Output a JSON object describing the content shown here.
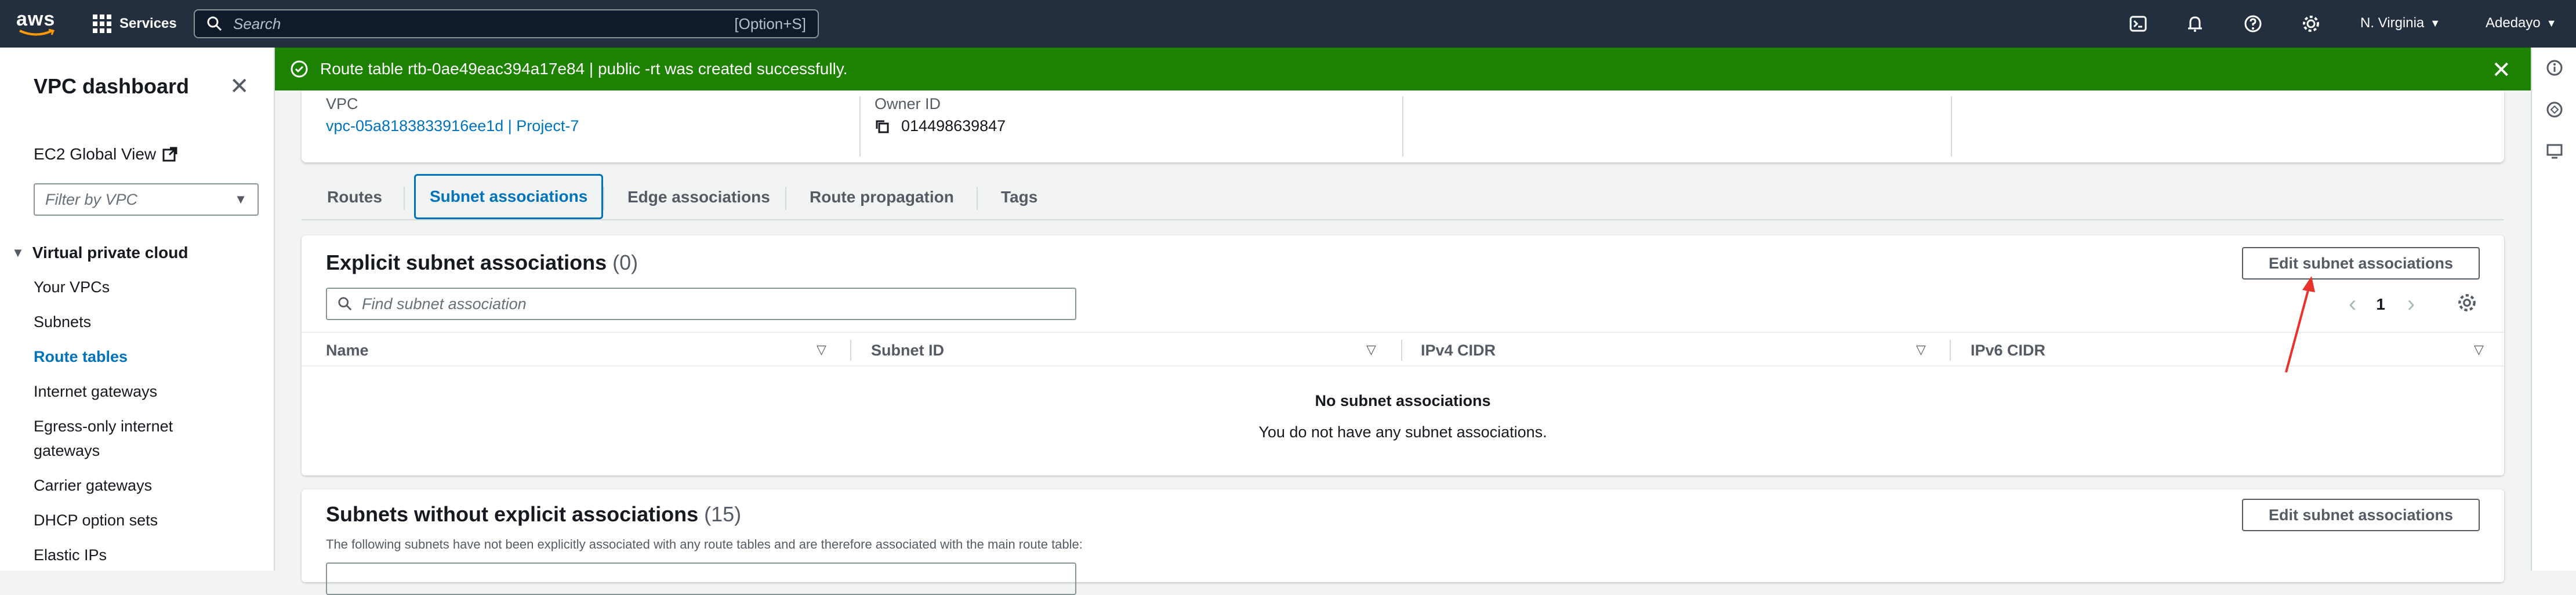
{
  "topnav": {
    "logo": "aws",
    "services_label": "Services",
    "search_placeholder": "Search",
    "search_shortcut": "[Option+S]",
    "region": "N. Virginia",
    "account": "Adedayo"
  },
  "flash": {
    "message": "Route table rtb-0ae49eac394a17e84 | public -rt was created successfully."
  },
  "sidenav": {
    "title": "VPC dashboard",
    "ec2_global_view": "EC2 Global View",
    "filter_placeholder": "Filter by VPC",
    "section": "Virtual private cloud",
    "items": [
      {
        "label": "Your VPCs"
      },
      {
        "label": "Subnets"
      },
      {
        "label": "Route tables",
        "active": true
      },
      {
        "label": "Internet gateways"
      },
      {
        "label": "Egress-only internet"
      },
      {
        "label": "gateways"
      },
      {
        "label": "Carrier gateways"
      },
      {
        "label": "DHCP option sets"
      },
      {
        "label": "Elastic IPs"
      }
    ]
  },
  "details": {
    "vpc_label": "VPC",
    "vpc_value": "vpc-05a8183833916ee1d | Project-7",
    "owner_label": "Owner ID",
    "owner_value": "014498639847"
  },
  "tabs": [
    "Routes",
    "Subnet associations",
    "Edge associations",
    "Route propagation",
    "Tags"
  ],
  "explicit": {
    "title": "Explicit subnet associations",
    "count": "(0)",
    "button": "Edit subnet associations",
    "search_placeholder": "Find subnet association",
    "page": "1",
    "columns": [
      "Name",
      "Subnet ID",
      "IPv4 CIDR",
      "IPv6 CIDR"
    ],
    "empty_title": "No subnet associations",
    "empty_sub": "You do not have any subnet associations."
  },
  "implicit": {
    "title": "Subnets without explicit associations",
    "count": "(15)",
    "button": "Edit subnet associations",
    "description": "The following subnets have not been explicitly associated with any route tables and are therefore associated with the main route table:"
  },
  "colors": {
    "nav_bg": "#232f3e",
    "success": "#1d8102",
    "link": "#0073bb",
    "annotation_arrow": "#e8322a"
  }
}
